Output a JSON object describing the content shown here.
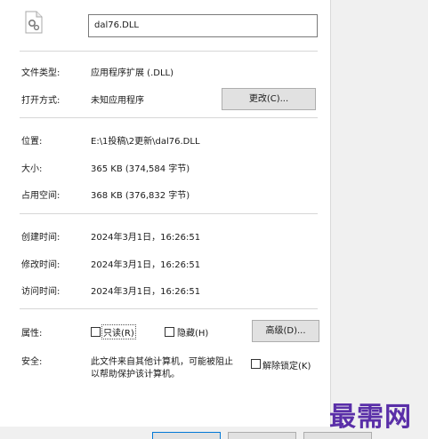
{
  "file": {
    "name_value": "dal76.DLL",
    "icon": "gear-file-icon"
  },
  "rows": {
    "type_label": "文件类型:",
    "type_value": "应用程序扩展 (.DLL)",
    "opens_label": "打开方式:",
    "opens_value": "未知应用程序",
    "change_button": "更改(C)...",
    "location_label": "位置:",
    "location_value": "E:\\1投稿\\2更新\\dal76.DLL",
    "size_label": "大小:",
    "size_value": "365 KB (374,584 字节)",
    "disk_label": "占用空间:",
    "disk_value": "368 KB (376,832 字节)",
    "created_label": "创建时间:",
    "created_value": "2024年3月1日，16:26:51",
    "modified_label": "修改时间:",
    "modified_value": "2024年3月1日，16:26:51",
    "accessed_label": "访问时间:",
    "accessed_value": "2024年3月1日，16:26:51"
  },
  "attributes": {
    "label": "属性:",
    "readonly": "只读(R)",
    "hidden": "隐藏(H)",
    "advanced_button": "高级(D)...",
    "readonly_checked": false,
    "hidden_checked": false
  },
  "security": {
    "label": "安全:",
    "text_line1": "此文件来自其他计算机，可能被阻止",
    "text_line2": "以帮助保护该计算机。",
    "unblock_label": "解除锁定(K)",
    "unblock_checked": false
  },
  "watermark": {
    "text": "最需网",
    "color": "#5a2fa8"
  }
}
